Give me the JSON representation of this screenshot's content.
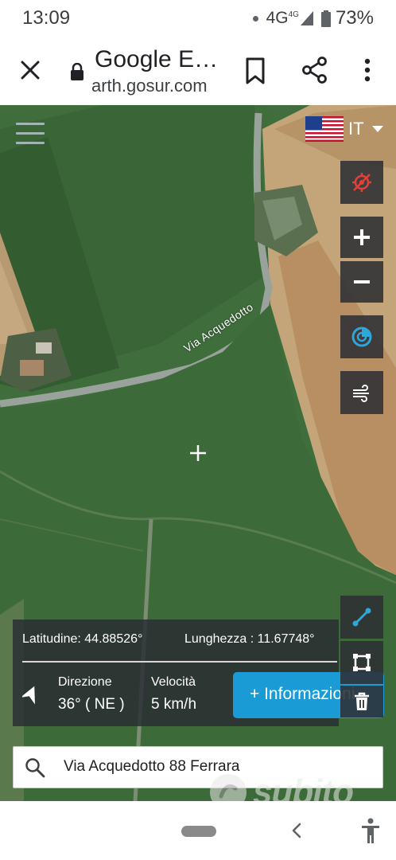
{
  "status_bar": {
    "time": "13:09",
    "network": "4G",
    "network_sup": "4G",
    "battery": "73%"
  },
  "browser": {
    "title": "Google E…",
    "url": "arth.gosur.com"
  },
  "map": {
    "road_label": "Via Acquedotto",
    "language": "IT"
  },
  "info_panel": {
    "latitude": "Latitudine: 44.88526°",
    "longitude": "Lunghezza : 11.67748°",
    "direction_label": "Direzione",
    "direction_value": "36° ( NE )",
    "speed_label": "Velocità",
    "speed_value": "5 km/h",
    "info_button": "+ Informazioni"
  },
  "search": {
    "value": "Via Acquedotto 88 Ferrara"
  },
  "watermark": {
    "text": "subito"
  },
  "colors": {
    "accent": "#1a9bd6",
    "panel": "#2c3036",
    "field_green": "#3d6b3b"
  },
  "icons": [
    "close-icon",
    "lock-icon",
    "bookmark-icon",
    "share-icon",
    "more-vert-icon",
    "hamburger-icon",
    "us-flag-icon",
    "location-off-icon",
    "zoom-in-icon",
    "zoom-out-icon",
    "layers-icon",
    "wind-icon",
    "route-icon",
    "area-icon",
    "trash-icon",
    "heading-arrow-icon",
    "search-icon",
    "accessibility-icon"
  ]
}
